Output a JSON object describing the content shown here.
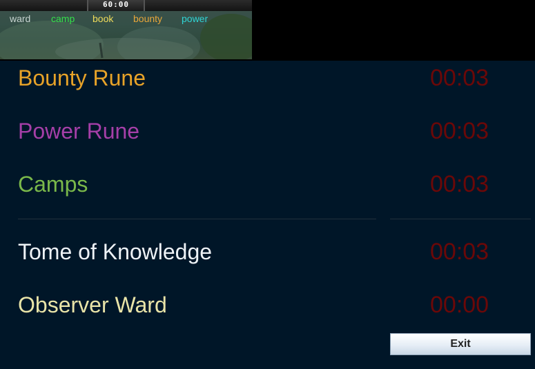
{
  "preview": {
    "clock": "60:00",
    "tags": {
      "ward": "ward",
      "camp": "camp",
      "book": "book",
      "bounty": "bounty",
      "power": "power"
    }
  },
  "timers": [
    {
      "label": "Bounty Rune",
      "time": "00:03",
      "color": "#e8a328"
    },
    {
      "label": "Power Rune",
      "time": "00:03",
      "color": "#a53fa8"
    },
    {
      "label": "Camps",
      "time": "00:03",
      "color": "#7ab84a"
    },
    {
      "label": "Tome of Knowledge",
      "time": "00:03",
      "color": "#eef2f6"
    },
    {
      "label": "Observer Ward",
      "time": "00:00",
      "color": "#e9e4a8"
    }
  ],
  "exit_label": "Exit"
}
